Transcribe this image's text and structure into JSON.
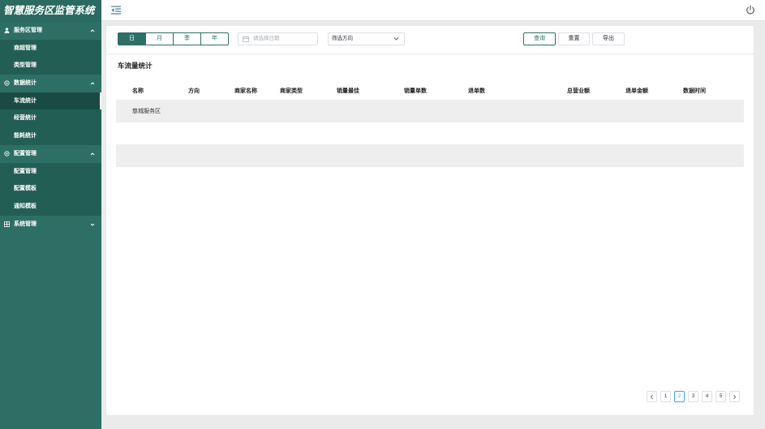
{
  "app": {
    "title": "智慧服务区监管系统"
  },
  "colors": {
    "primary": "#2e7066",
    "sidebar": "#2d6f65",
    "submenu": "#235e55",
    "active_item": "#1a4b43",
    "page_active": "#409eff",
    "row_stripe": "#eeeeee"
  },
  "topbar": {
    "toggle_icon": "outdent-icon",
    "logout_icon": "power-icon"
  },
  "sidebar": {
    "groups": [
      {
        "label": "服务区管理",
        "icon": "user-icon",
        "expanded": true,
        "items": [
          {
            "label": "商超管理"
          },
          {
            "label": "类型管理"
          }
        ]
      },
      {
        "label": "数据统计",
        "icon": "settings-icon",
        "expanded": true,
        "items": [
          {
            "label": "车流统计",
            "active": true
          },
          {
            "label": "经营统计"
          },
          {
            "label": "能耗统计"
          }
        ]
      },
      {
        "label": "配置管理",
        "icon": "settings-icon",
        "expanded": true,
        "items": [
          {
            "label": "配置管理"
          },
          {
            "label": "配置模板"
          },
          {
            "label": "通知模板"
          }
        ]
      },
      {
        "label": "系统管理",
        "icon": "grid-icon",
        "expanded": false,
        "items": []
      }
    ]
  },
  "filters": {
    "period_tabs": [
      {
        "label": "日",
        "active": true
      },
      {
        "label": "月"
      },
      {
        "label": "季"
      },
      {
        "label": "年"
      }
    ],
    "date": {
      "icon": "calendar-icon",
      "placeholder": "请选择日期"
    },
    "direction": {
      "icon": "chevron-down-icon",
      "placeholder": "筛选方向"
    },
    "buttons": {
      "query": "查询",
      "reset": "重置",
      "export": "导出"
    }
  },
  "section": {
    "title": "车流量统计"
  },
  "table": {
    "columns": [
      "名称",
      "方向",
      "商家名称",
      "商家类型",
      "销量最佳",
      "销量单数",
      "退单数",
      "总营业额",
      "退单金额",
      "数据时间"
    ],
    "rows": [
      [
        "慈城服务区",
        "",
        "",
        "",
        "",
        "",
        "",
        "",
        "",
        ""
      ],
      [
        "",
        "",
        "",
        "",
        "",
        "",
        "",
        "",
        "",
        ""
      ],
      [
        "",
        "",
        "",
        "",
        "",
        "",
        "",
        "",
        "",
        ""
      ]
    ]
  },
  "pagination": {
    "prev_icon": "chevron-left-icon",
    "next_icon": "chevron-right-icon",
    "pages": [
      {
        "label": "1"
      },
      {
        "label": "2",
        "active": true
      },
      {
        "label": "3"
      },
      {
        "label": "4"
      },
      {
        "label": "5"
      }
    ]
  }
}
